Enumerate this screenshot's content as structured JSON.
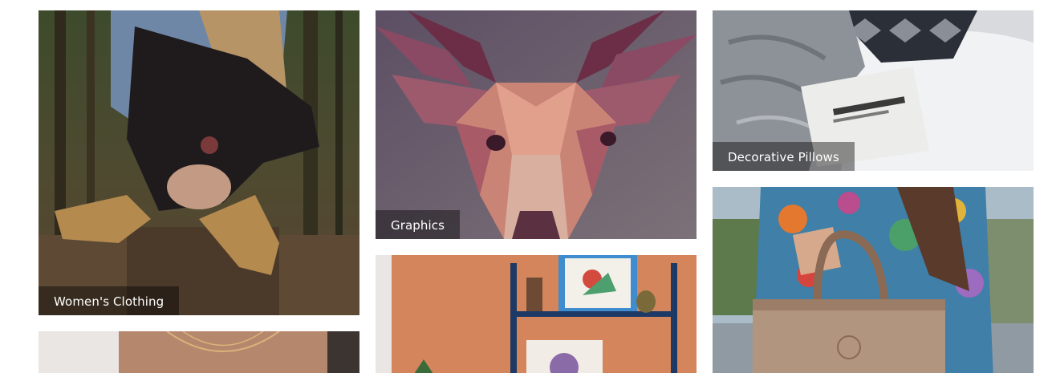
{
  "categories": [
    {
      "key": "women",
      "label": "Women's Clothing"
    },
    {
      "key": "graphics",
      "label": "Graphics"
    },
    {
      "key": "pillows",
      "label": "Decorative Pillows"
    },
    {
      "key": "jewelry",
      "label": ""
    },
    {
      "key": "decor",
      "label": ""
    },
    {
      "key": "bags",
      "label": ""
    }
  ],
  "palette": {
    "caption_bg": "#00000066",
    "caption_text": "#ffffff",
    "page_bg": "#ffffff"
  }
}
